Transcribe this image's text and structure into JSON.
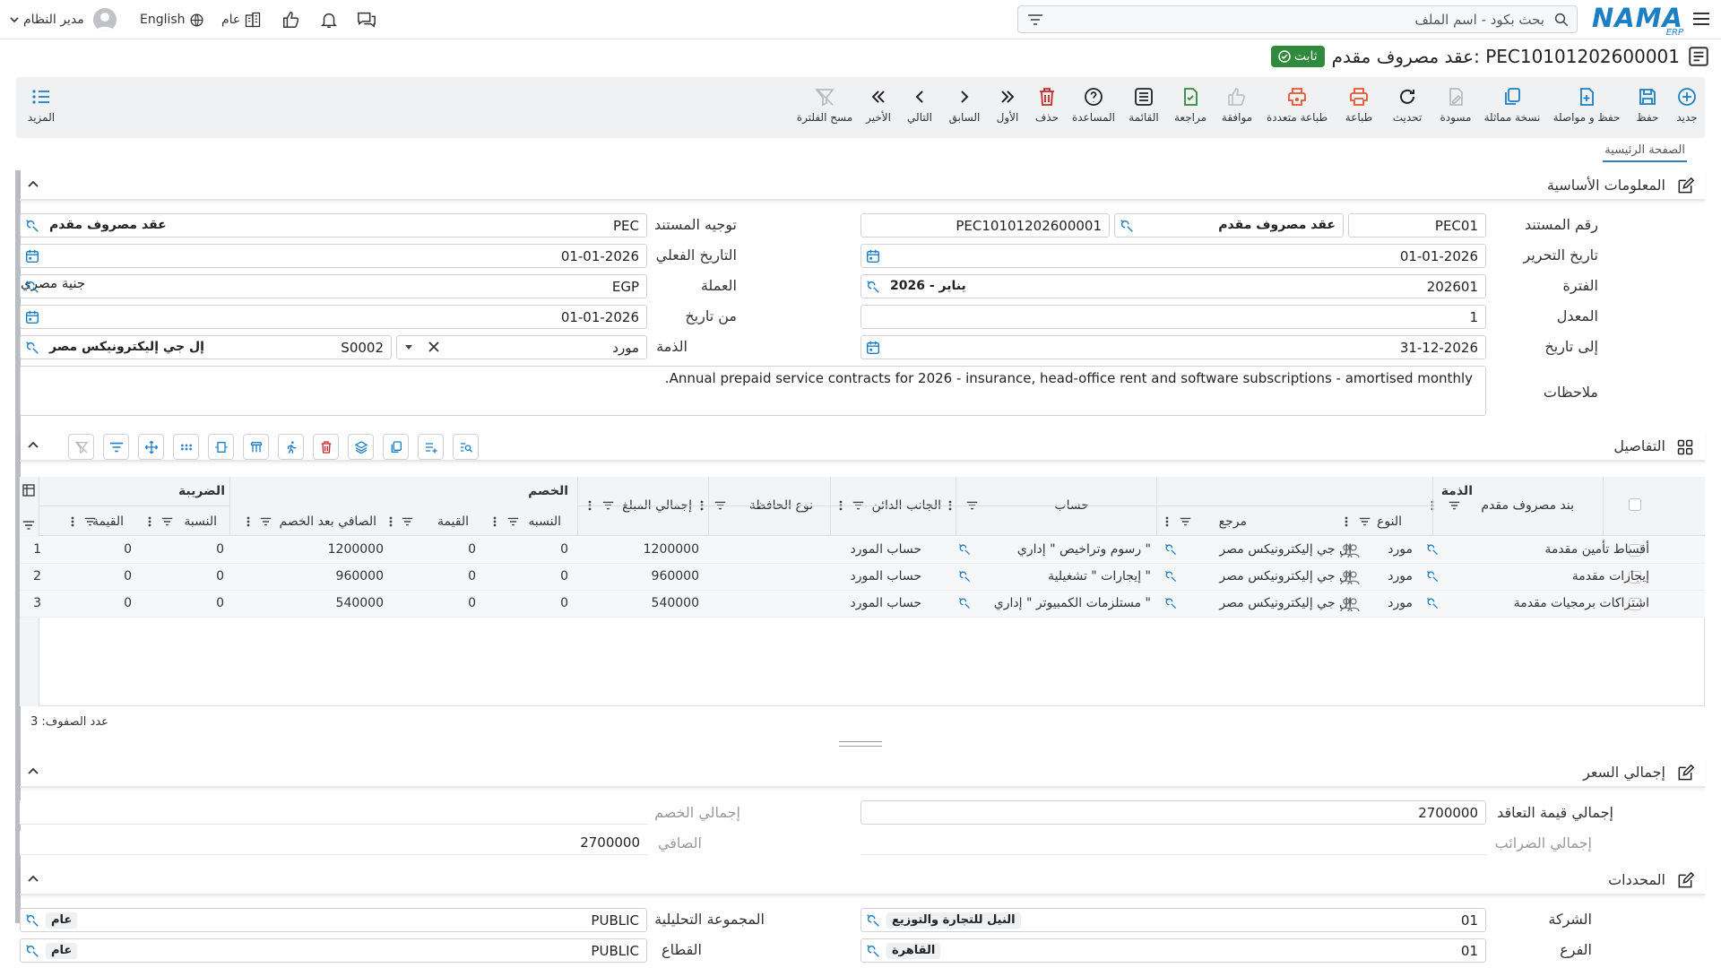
{
  "topbar": {
    "logo_text": "NAMA",
    "logo_sub": "ERP",
    "search_placeholder": "بحث بكود - اسم الملف",
    "user_name": "مدير النظام",
    "language": "English",
    "scope": "عام"
  },
  "title": {
    "text": "عقد مصروف مقدم: PEC10101202600001",
    "status": "ثابت"
  },
  "toolbar": {
    "items": [
      "جديد",
      "حفظ",
      "حفظ و مواصلة",
      "نسخة مماثلة",
      "مسودة",
      "تحديث",
      "طباعة",
      "طباعة متعددة",
      "موافقة",
      "مراجعة",
      "القائمة",
      "المساعدة",
      "حذف",
      "الأول",
      "السابق",
      "التالي",
      "الأخير",
      "مسح الفلترة"
    ],
    "more": "المزيد"
  },
  "tabs": {
    "main": "الصفحة الرئيسية"
  },
  "sections": {
    "basic": "المعلومات الأساسية",
    "details": "التفاصيل",
    "price": "إجمالي السعر",
    "dims": "المحددات"
  },
  "form": {
    "doc_no_label": "رقم المستند",
    "doc_no_code": "PEC01",
    "doc_no_type": "عقد مصروف مقدم",
    "doc_no_value": "PEC10101202600001",
    "direction_label": "توجيه المستند",
    "direction_code": "PEC",
    "direction_name": "عقد مصروف مقدم",
    "write_date_label": "تاريخ التحرير",
    "write_date": "01-01-2026",
    "actual_date_label": "التاريخ الفعلي",
    "actual_date": "01-01-2026",
    "period_label": "الفترة",
    "period_code": "202601",
    "period_name": "2026 - يناير",
    "currency_label": "العملة",
    "currency_code": "EGP",
    "currency_name": "جنية مصري",
    "rate_label": "المعدل",
    "rate": "1",
    "from_date_label": "من تاريخ",
    "from_date": "01-01-2026",
    "to_date_label": "إلى تاريخ",
    "to_date": "31-12-2026",
    "party_label": "الذمة",
    "party_type": "مورد",
    "party_code": "S0002",
    "party_name": "إل جي إليكترونيكس مصر",
    "notes_label": "ملاحظات",
    "notes": "Annual prepaid service contracts for 2026 - insurance, head-office rent and software subscriptions - amortised monthly."
  },
  "table": {
    "headers": {
      "item": "بند مصروف مقدم",
      "party_group": "الذمة",
      "type": "النوع",
      "ref": "مرجع",
      "account": "حساب",
      "creditor": "الجانب الدائن",
      "portfolio": "نوع الحافظة",
      "total": "إجمالي المبلغ",
      "discount_group": "الخصم",
      "disc_pct": "النسبه",
      "disc_val": "القيمة",
      "net_after": "الصافي بعد الخصم",
      "tax_group": "الضريبة",
      "tax_pct": "النسبة",
      "tax_val": "القيمة"
    },
    "rows": [
      {
        "n": "1",
        "item": "أقساط تأمين مقدمة",
        "type": "مورد",
        "ref": "إل جي إليكترونيكس مصر",
        "account": "رسوم وتراخيص \" إداري \"",
        "creditor": "حساب المورد",
        "total": "1200000",
        "disc_pct": "0",
        "disc_val": "0",
        "net": "1200000",
        "tax_pct": "0",
        "tax_val": "0"
      },
      {
        "n": "2",
        "item": "إيجارات مقدمة",
        "type": "مورد",
        "ref": "إل جي إليكترونيكس مصر",
        "account": "إيجارات \" تشغيلية \"",
        "creditor": "حساب المورد",
        "total": "960000",
        "disc_pct": "0",
        "disc_val": "0",
        "net": "960000",
        "tax_pct": "0",
        "tax_val": "0"
      },
      {
        "n": "3",
        "item": "اشتراكات برمجيات مقدمة",
        "type": "مورد",
        "ref": "إل جي إليكترونيكس مصر",
        "account": "مستلزمات الكمبيوتر \" إداري \"",
        "creditor": "حساب المورد",
        "total": "540000",
        "disc_pct": "0",
        "disc_val": "0",
        "net": "540000",
        "tax_pct": "0",
        "tax_val": "0"
      }
    ],
    "row_count": "عدد الصفوف: 3"
  },
  "price": {
    "contract_total_label": "إجمالي قيمة التعاقد",
    "contract_total": "2700000",
    "discount_total_label": "إجمالي الخصم",
    "discount_total": "",
    "tax_total_label": "إجمالي الضرائب",
    "tax_total": "",
    "net_label": "الصافي",
    "net": "2700000"
  },
  "dims": {
    "company_label": "الشركة",
    "company_code": "01",
    "company_name": "النيل للتجارة والتوزيع",
    "analytic_label": "المجموعة التحليلية",
    "analytic_code": "PUBLIC",
    "analytic_name": "عام",
    "branch_label": "الفرع",
    "branch_code": "01",
    "branch_name": "القاهرة",
    "sector_label": "القطاع",
    "sector_code": "PUBLIC",
    "sector_name": "عام"
  },
  "colors": {
    "accent": "#1c7fc4",
    "status": "#2f8a3b",
    "danger": "#c62828",
    "toolbar_bg": "#f0f1f3"
  }
}
